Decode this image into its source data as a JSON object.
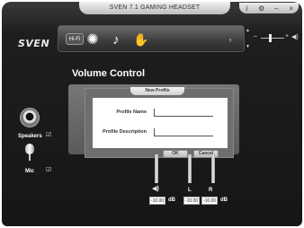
{
  "window": {
    "title": "SVEN 7.1 GAMING HEADSET",
    "controls": [
      "i",
      "⚙",
      "–",
      "×"
    ]
  },
  "logo": "SVEN",
  "toolbar": {
    "hifi_label": "Hi-Fi",
    "surround_icon": "✺",
    "music_icon": "♪",
    "hand_icon": "✋",
    "next_icon": "›"
  },
  "master_volume": {
    "minus": "–",
    "plus": "+",
    "speaker_icon": "◀)"
  },
  "sidebar": {
    "items": [
      {
        "label": "Speakers",
        "checkbox": "☑"
      },
      {
        "label": "Mic",
        "checkbox": "☑"
      }
    ]
  },
  "main": {
    "title": "Volume Control"
  },
  "dialog": {
    "title": "New Profile",
    "profile_name_label": "Profile Name",
    "profile_name_value": "",
    "profile_description_label": "Profile Description",
    "profile_description_value": "",
    "ok_label": "OK",
    "cancel_label": "Cancel"
  },
  "volume": {
    "mute_icon": "◀)",
    "main_value": "-10.00",
    "left_label": "L",
    "right_label": "R",
    "left_value": "-10.00",
    "right_value": "-10.00",
    "unit": "dB"
  }
}
